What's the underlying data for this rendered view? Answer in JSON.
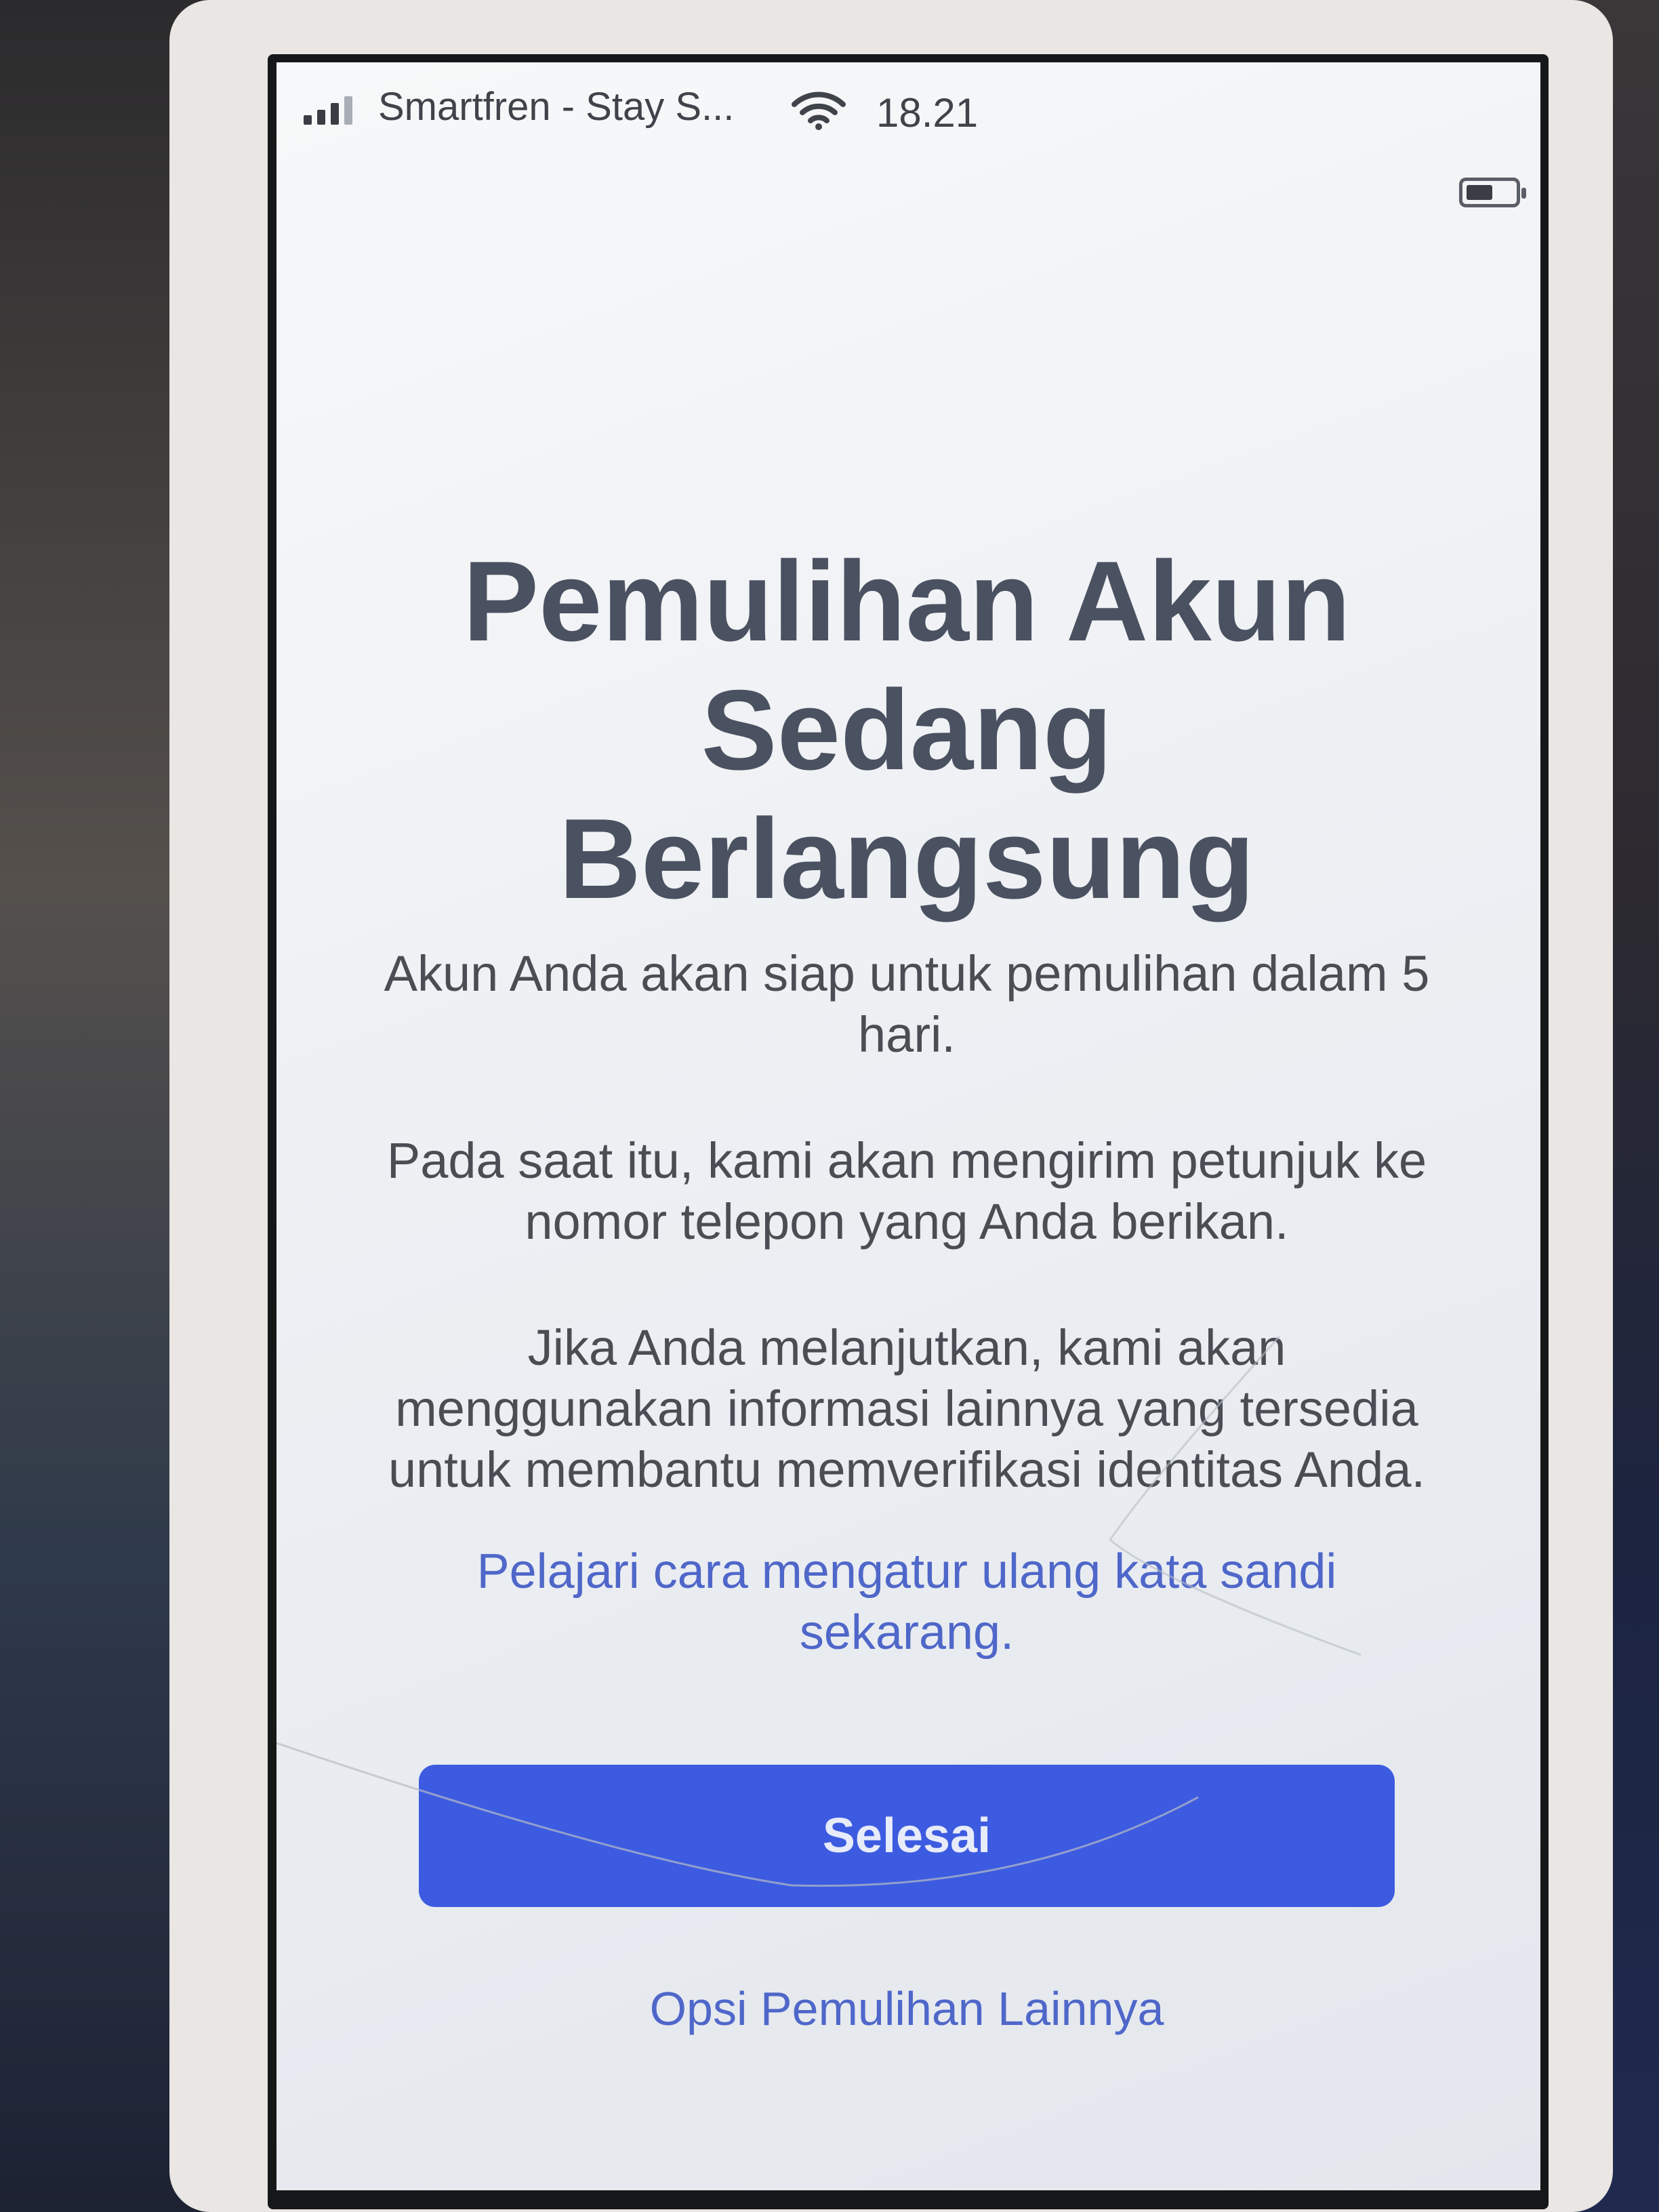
{
  "status_bar": {
    "carrier": "Smartfren - Stay S...",
    "time": "18.21"
  },
  "recovery": {
    "title_line1": "Pemulihan Akun",
    "title_line2": "Sedang",
    "title_line3": "Berlangsung",
    "paragraph1": "Akun Anda akan siap untuk pemulihan dalam 5 hari.",
    "paragraph2": "Pada saat itu, kami akan mengirim petunjuk ke nomor telepon yang Anda berikan.",
    "paragraph3": "Jika Anda melanjutkan, kami akan menggunakan informasi lainnya yang tersedia untuk membantu memverifikasi identitas Anda.",
    "learn_link": "Pelajari cara mengatur ulang kata sandi sekarang.",
    "done_button": "Selesai",
    "other_options_link": "Opsi Pemulihan Lainnya"
  },
  "colors": {
    "accent": "#3c5be0",
    "link": "#4f67c9",
    "title": "#4a5160"
  },
  "icons": [
    "signal-icon",
    "wifi-icon",
    "battery-icon"
  ]
}
